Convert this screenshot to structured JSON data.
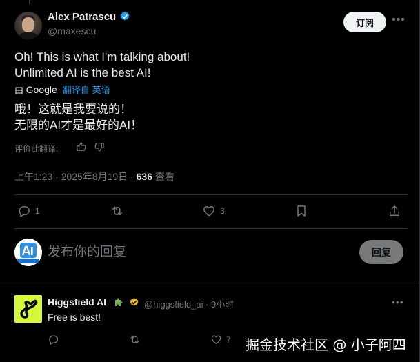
{
  "post": {
    "author_name": "Alex Patrascu",
    "author_handle": "@maxescu",
    "follow_label": "订阅",
    "more_icon": "more-horizontal-icon",
    "text_original": [
      "Oh! This is what I'm talking about!",
      "Unlimited AI is the best AI!"
    ],
    "translated_by_prefix": "由 ",
    "translated_by_brand": "Google",
    "translate_from_label": "翻译自 英语",
    "text_translated": [
      "哦！这就是我要说的！",
      "无限的AI才是最好的AI！"
    ],
    "rate_label": "评价此翻译:",
    "timestamp": "上午1:23 · 2025年8月19日 · ",
    "views_count": "636",
    "views_label": " 查看",
    "actions": {
      "reply_count": "1",
      "retweet_count": "",
      "like_count": "3"
    }
  },
  "composer": {
    "placeholder": "发布你的回复",
    "reply_button": "回复"
  },
  "reply": {
    "author_name": "Higgsfield AI",
    "author_handle": "@higgsfield_ai",
    "time": "· 9小时",
    "text": "Free is best!",
    "like_count": "7"
  },
  "watermark": "掘金技术社区 @ 小子阿四",
  "colors": {
    "background": "#000000",
    "text": "#e7e9ea",
    "muted": "#71767b",
    "accent": "#1d9bf0",
    "verified_gold": "#e2b719",
    "higgsfield_brand": "#d4f83a"
  }
}
